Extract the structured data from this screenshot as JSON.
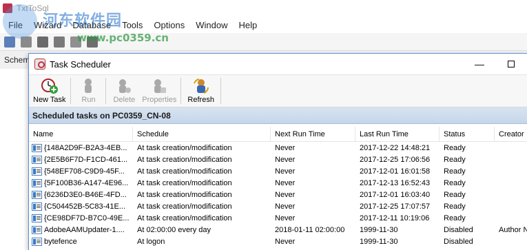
{
  "app": {
    "title": "TxtToSql",
    "menu": [
      "File",
      "Wizard",
      "Database",
      "Tools",
      "Options",
      "Window",
      "Help"
    ],
    "tab": "Schem",
    "toolbar_icons": [
      "user-icon",
      "export-icon",
      "table-icon",
      "grid-icon",
      "settings-icon",
      "chart-icon"
    ]
  },
  "watermark": {
    "text": "河东软件园",
    "url": "www.pc0359.cn"
  },
  "window": {
    "title": "Task Scheduler",
    "minimize": "—",
    "close": "✕"
  },
  "toolbar": {
    "buttons": [
      {
        "label": "New Task",
        "icon": "new-task-icon",
        "enabled": true
      },
      {
        "label": "Run",
        "icon": "run-icon",
        "enabled": false
      },
      {
        "label": "Delete",
        "icon": "delete-icon",
        "enabled": false
      },
      {
        "label": "Properties",
        "icon": "properties-icon",
        "enabled": false
      },
      {
        "label": "Refresh",
        "icon": "refresh-icon",
        "enabled": true
      }
    ]
  },
  "header": "Scheduled tasks on PC0359_CN-08",
  "columns": [
    "Name",
    "Schedule",
    "Next Run Time",
    "Last Run Time",
    "Status",
    "Creator"
  ],
  "rows": [
    {
      "name": "{148A2D9F-B2A3-4EB...",
      "schedule": "At task creation/modification",
      "next": "Never",
      "last": "2017-12-22 14:48:21",
      "status": "Ready",
      "creator": ""
    },
    {
      "name": "{2E5B6F7D-F1CD-461...",
      "schedule": "At task creation/modification",
      "next": "Never",
      "last": "2017-12-25 17:06:56",
      "status": "Ready",
      "creator": ""
    },
    {
      "name": "{548EF708-C9D9-45F...",
      "schedule": "At task creation/modification",
      "next": "Never",
      "last": "2017-12-01 16:01:58",
      "status": "Ready",
      "creator": ""
    },
    {
      "name": "{5F100B36-A147-4E96...",
      "schedule": "At task creation/modification",
      "next": "Never",
      "last": "2017-12-13 16:52:43",
      "status": "Ready",
      "creator": ""
    },
    {
      "name": "{6236D3E0-B46E-4FD...",
      "schedule": "At task creation/modification",
      "next": "Never",
      "last": "2017-12-01 16:03:40",
      "status": "Ready",
      "creator": ""
    },
    {
      "name": "{C504452B-5C83-41E...",
      "schedule": "At task creation/modification",
      "next": "Never",
      "last": "2017-12-25 17:07:57",
      "status": "Ready",
      "creator": ""
    },
    {
      "name": "{CE98DF7D-B7C0-49E...",
      "schedule": "At task creation/modification",
      "next": "Never",
      "last": "2017-12-11 10:19:06",
      "status": "Ready",
      "creator": ""
    },
    {
      "name": "AdobeAAMUpdater-1....",
      "schedule": "At 02:00:00 every day",
      "next": "2018-01-11 02:00:00",
      "last": "1999-11-30",
      "status": "Disabled",
      "creator": "Author N"
    },
    {
      "name": "bytefence",
      "schedule": "At logon",
      "next": "Never",
      "last": "1999-11-30",
      "status": "Disabled",
      "creator": ""
    }
  ]
}
